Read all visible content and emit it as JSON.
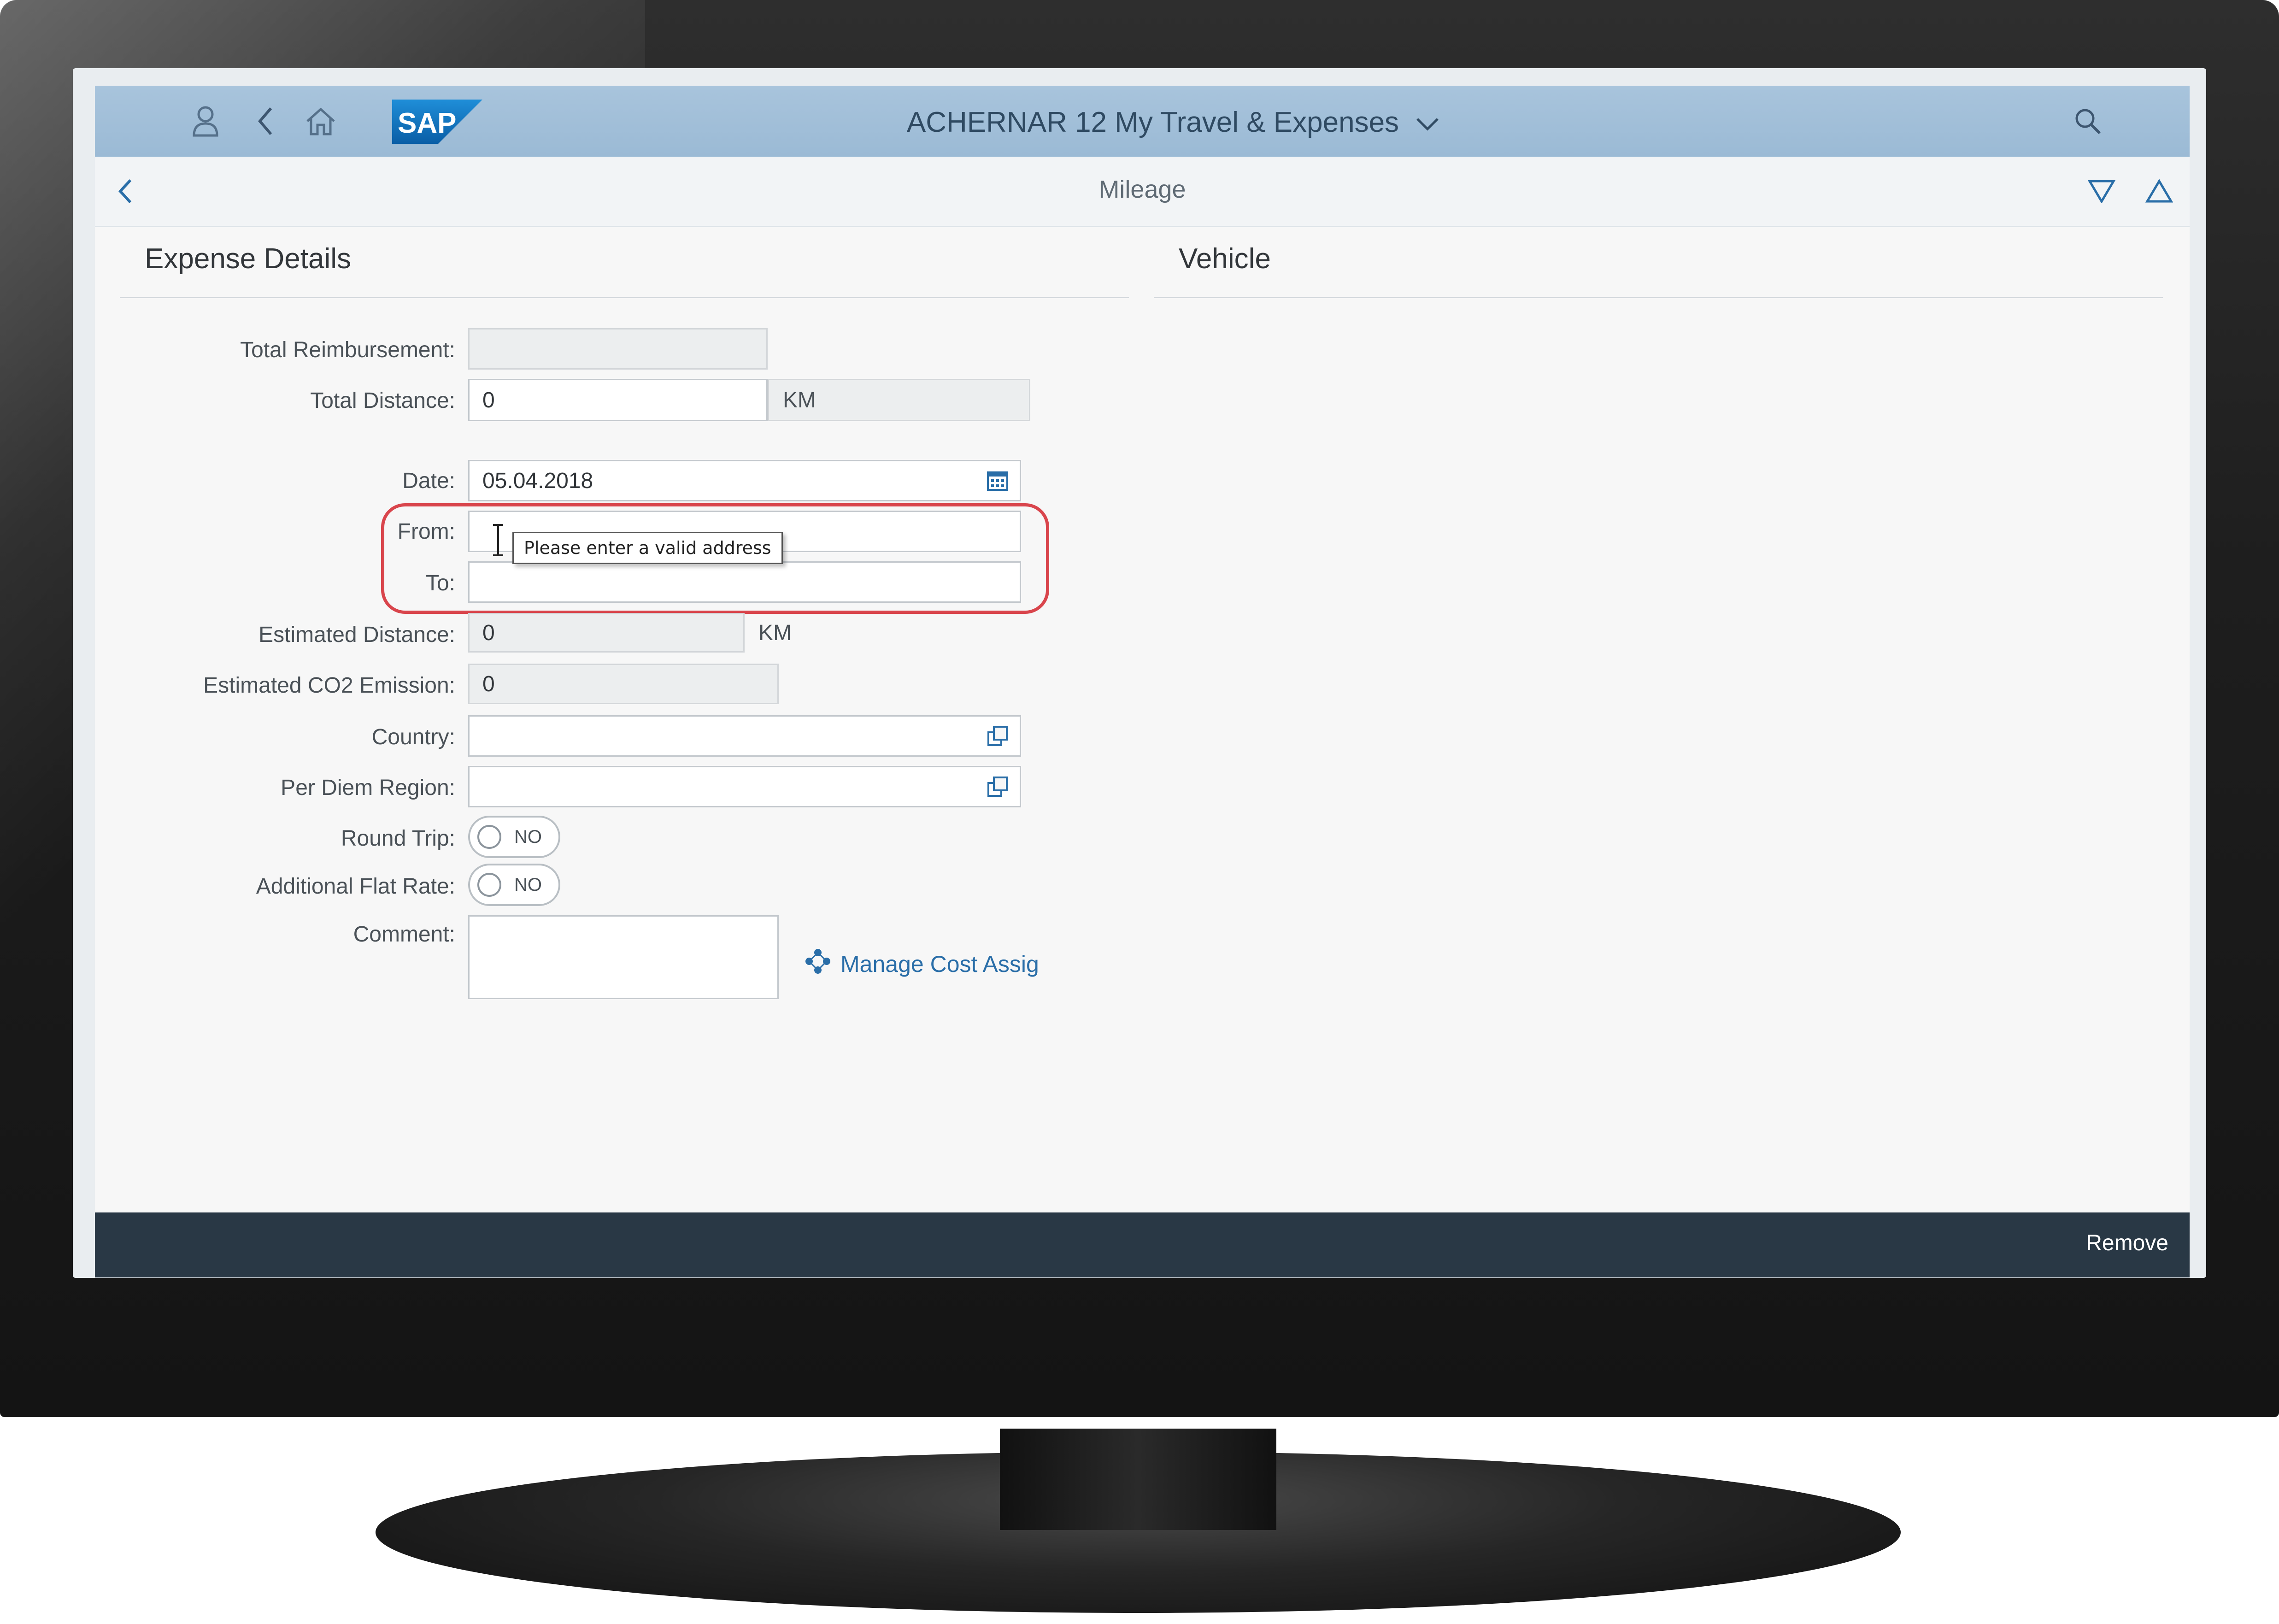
{
  "shell": {
    "app_title": "ACHERNAR 12 My Travel & Expenses",
    "logo_text": "SAP"
  },
  "page": {
    "title": "Mileage"
  },
  "sections": {
    "expense_details": "Expense Details",
    "vehicle": "Vehicle"
  },
  "form": {
    "total_reimbursement": {
      "label": "Total Reimbursement:",
      "value": ""
    },
    "total_distance": {
      "label": "Total Distance:",
      "value": "0",
      "unit": "KM"
    },
    "date": {
      "label": "Date:",
      "value": "05.04.2018"
    },
    "from": {
      "label": "From:",
      "value": "",
      "tooltip": "Please enter a valid address"
    },
    "to": {
      "label": "To:",
      "value": ""
    },
    "estimated_distance": {
      "label": "Estimated Distance:",
      "value": "0",
      "unit": "KM"
    },
    "estimated_co2": {
      "label": "Estimated CO2 Emission:",
      "value": "0"
    },
    "country": {
      "label": "Country:",
      "value": ""
    },
    "per_diem_region": {
      "label": "Per Diem Region:",
      "value": ""
    },
    "round_trip": {
      "label": "Round Trip:",
      "state": "NO"
    },
    "additional_flat_rate": {
      "label": "Additional Flat Rate:",
      "state": "NO"
    },
    "comment": {
      "label": "Comment:",
      "value": ""
    }
  },
  "links": {
    "manage_cost": "Manage Cost Assig"
  },
  "footer": {
    "remove": "Remove"
  },
  "colors": {
    "shell_header": "#9bbad5",
    "footer": "#293845",
    "highlight": "#d9454c",
    "link": "#2a6ea8"
  },
  "icons": [
    "user-icon",
    "back-icon",
    "home-icon",
    "chevron-down-icon",
    "search-icon",
    "nav-back-icon",
    "filter-down-icon",
    "filter-up-icon",
    "calendar-icon",
    "value-help-icon",
    "cost-assignment-icon"
  ]
}
